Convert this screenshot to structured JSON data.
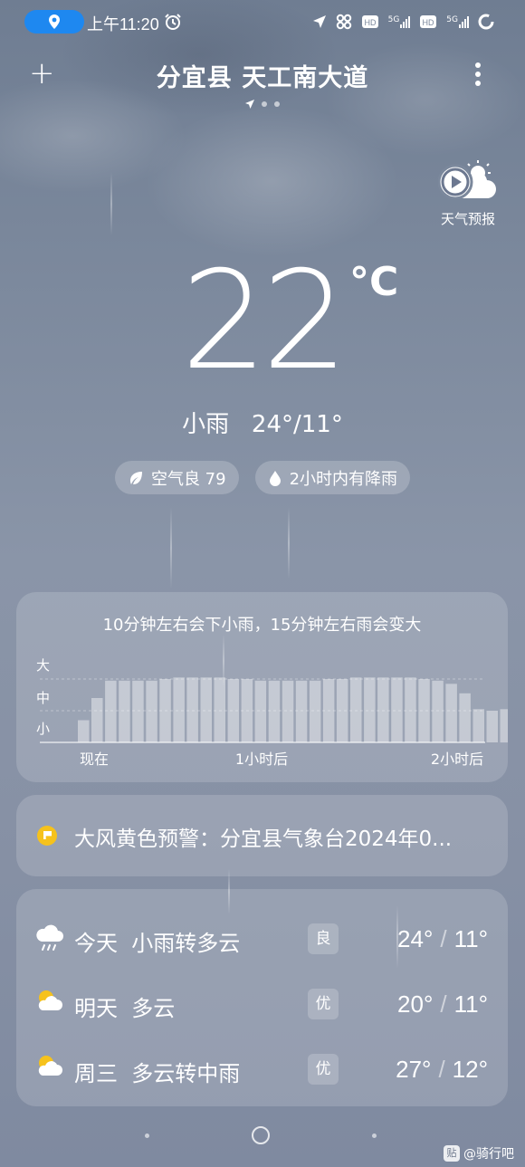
{
  "status_bar": {
    "time": "上午11:20",
    "network_1": "5G",
    "network_2": "5G"
  },
  "header": {
    "title": "分宜县 天工南大道"
  },
  "forecast_button": {
    "label": "天气预报"
  },
  "current": {
    "temperature": "22",
    "unit": "°C",
    "condition_line": "小雨   24°/11°"
  },
  "chips": {
    "air_quality": "空气良 79",
    "rain_notice": "2小时内有降雨"
  },
  "precipitation": {
    "title": "10分钟左右会下小雨，15分钟左右雨会变大",
    "levels": [
      "大",
      "中",
      "小"
    ],
    "time_labels": [
      "现在",
      "1小时后",
      "2小时后"
    ],
    "chart_data": {
      "type": "bar",
      "ylim": [
        0,
        3
      ],
      "values": [
        0.7,
        1.4,
        1.95,
        1.95,
        1.95,
        1.95,
        2.0,
        2.05,
        2.05,
        2.05,
        2.05,
        2.0,
        2.0,
        1.95,
        1.95,
        1.95,
        1.95,
        1.95,
        2.0,
        2.0,
        2.05,
        2.05,
        2.05,
        2.05,
        2.05,
        2.0,
        1.95,
        1.85,
        1.55,
        1.05,
        1.0,
        1.05,
        1.3,
        1.75,
        1.75,
        1.75
      ]
    }
  },
  "warning": {
    "text": "大风黄色预警：分宜县气象台2024年0..."
  },
  "daily": [
    {
      "day": "今天  小雨转多云",
      "aqi": "良",
      "high": "24°",
      "low": "11°",
      "sep": "/",
      "icon": "rain-cloud-icon"
    },
    {
      "day": "明天  多云",
      "aqi": "优",
      "high": "20°",
      "low": "11°",
      "sep": "/",
      "icon": "partly-cloudy-icon"
    },
    {
      "day": "周三  多云转中雨",
      "aqi": "优",
      "high": "27°",
      "low": "12°",
      "sep": "/",
      "icon": "partly-cloudy-icon"
    }
  ],
  "watermark": {
    "badge": "贴",
    "text": "@骑行吧"
  }
}
